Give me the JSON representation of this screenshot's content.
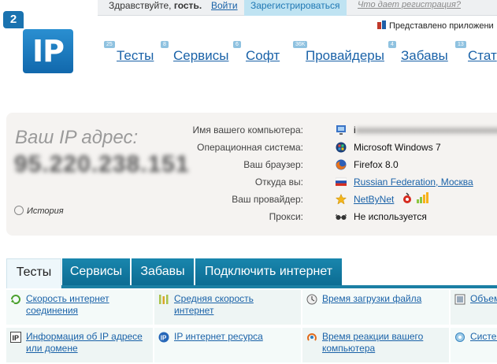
{
  "topbar": {
    "greeting": "Здравствуйте,",
    "guest": "гость.",
    "login": "Войти",
    "register": "Зарегистрироваться",
    "what_registration": "Что дает регистрация?"
  },
  "partner": {
    "text": "Представлено приложени"
  },
  "logo": {
    "badge": "2",
    "text": "IP"
  },
  "nav": [
    {
      "count": "25",
      "label": "Тесты"
    },
    {
      "count": "8",
      "label": "Сервисы"
    },
    {
      "count": "6",
      "label": "Софт"
    },
    {
      "count": "36K",
      "label": "Провайдеры"
    },
    {
      "count": "4",
      "label": "Забавы"
    },
    {
      "count": "13",
      "label": "Стат"
    }
  ],
  "ip_panel": {
    "title": "Ваш IP адрес:",
    "ip": "95.220.238.151",
    "history": "История",
    "rows": [
      {
        "label": "Имя вашего компьютера:",
        "icon": "computer-icon",
        "value": "i"
      },
      {
        "label": "Операционная система:",
        "icon": "windows-icon",
        "value": "Microsoft Windows 7"
      },
      {
        "label": "Ваш браузер:",
        "icon": "firefox-icon",
        "value": "Firefox 8.0"
      },
      {
        "label": "Откуда вы:",
        "icon": "russia-flag-icon",
        "value": "Russian Federation, Москва"
      },
      {
        "label": "Ваш провайдер:",
        "icon": "star-icon",
        "value": "NetByNet"
      },
      {
        "label": "Прокси:",
        "icon": "glasses-icon",
        "value": "Не используется"
      }
    ]
  },
  "tabs": [
    {
      "label": "Тесты"
    },
    {
      "label": "Сервисы"
    },
    {
      "label": "Забавы"
    },
    {
      "label": "Подключить интернет"
    }
  ],
  "links": [
    {
      "label": "Скорость интернет соединения",
      "icon": "speed-arrow-icon"
    },
    {
      "label": "Средняя скорость интернет",
      "icon": "bars-icon"
    },
    {
      "label": "Время загрузки файла",
      "icon": "clock-icon"
    },
    {
      "label": "Объем",
      "icon": "volume-icon"
    },
    {
      "label": "Информация об IP адресе или домене",
      "icon": "ip-info-icon"
    },
    {
      "label": "IP интернет ресурса",
      "icon": "ip-resource-icon"
    },
    {
      "label": "Время реакции вашего компьютера",
      "icon": "reaction-icon"
    },
    {
      "label": "Систем",
      "icon": "system-icon"
    }
  ],
  "colors": {
    "accent": "#1a73b0",
    "tab_bg": "#1383ab",
    "link": "#1a62a8"
  }
}
